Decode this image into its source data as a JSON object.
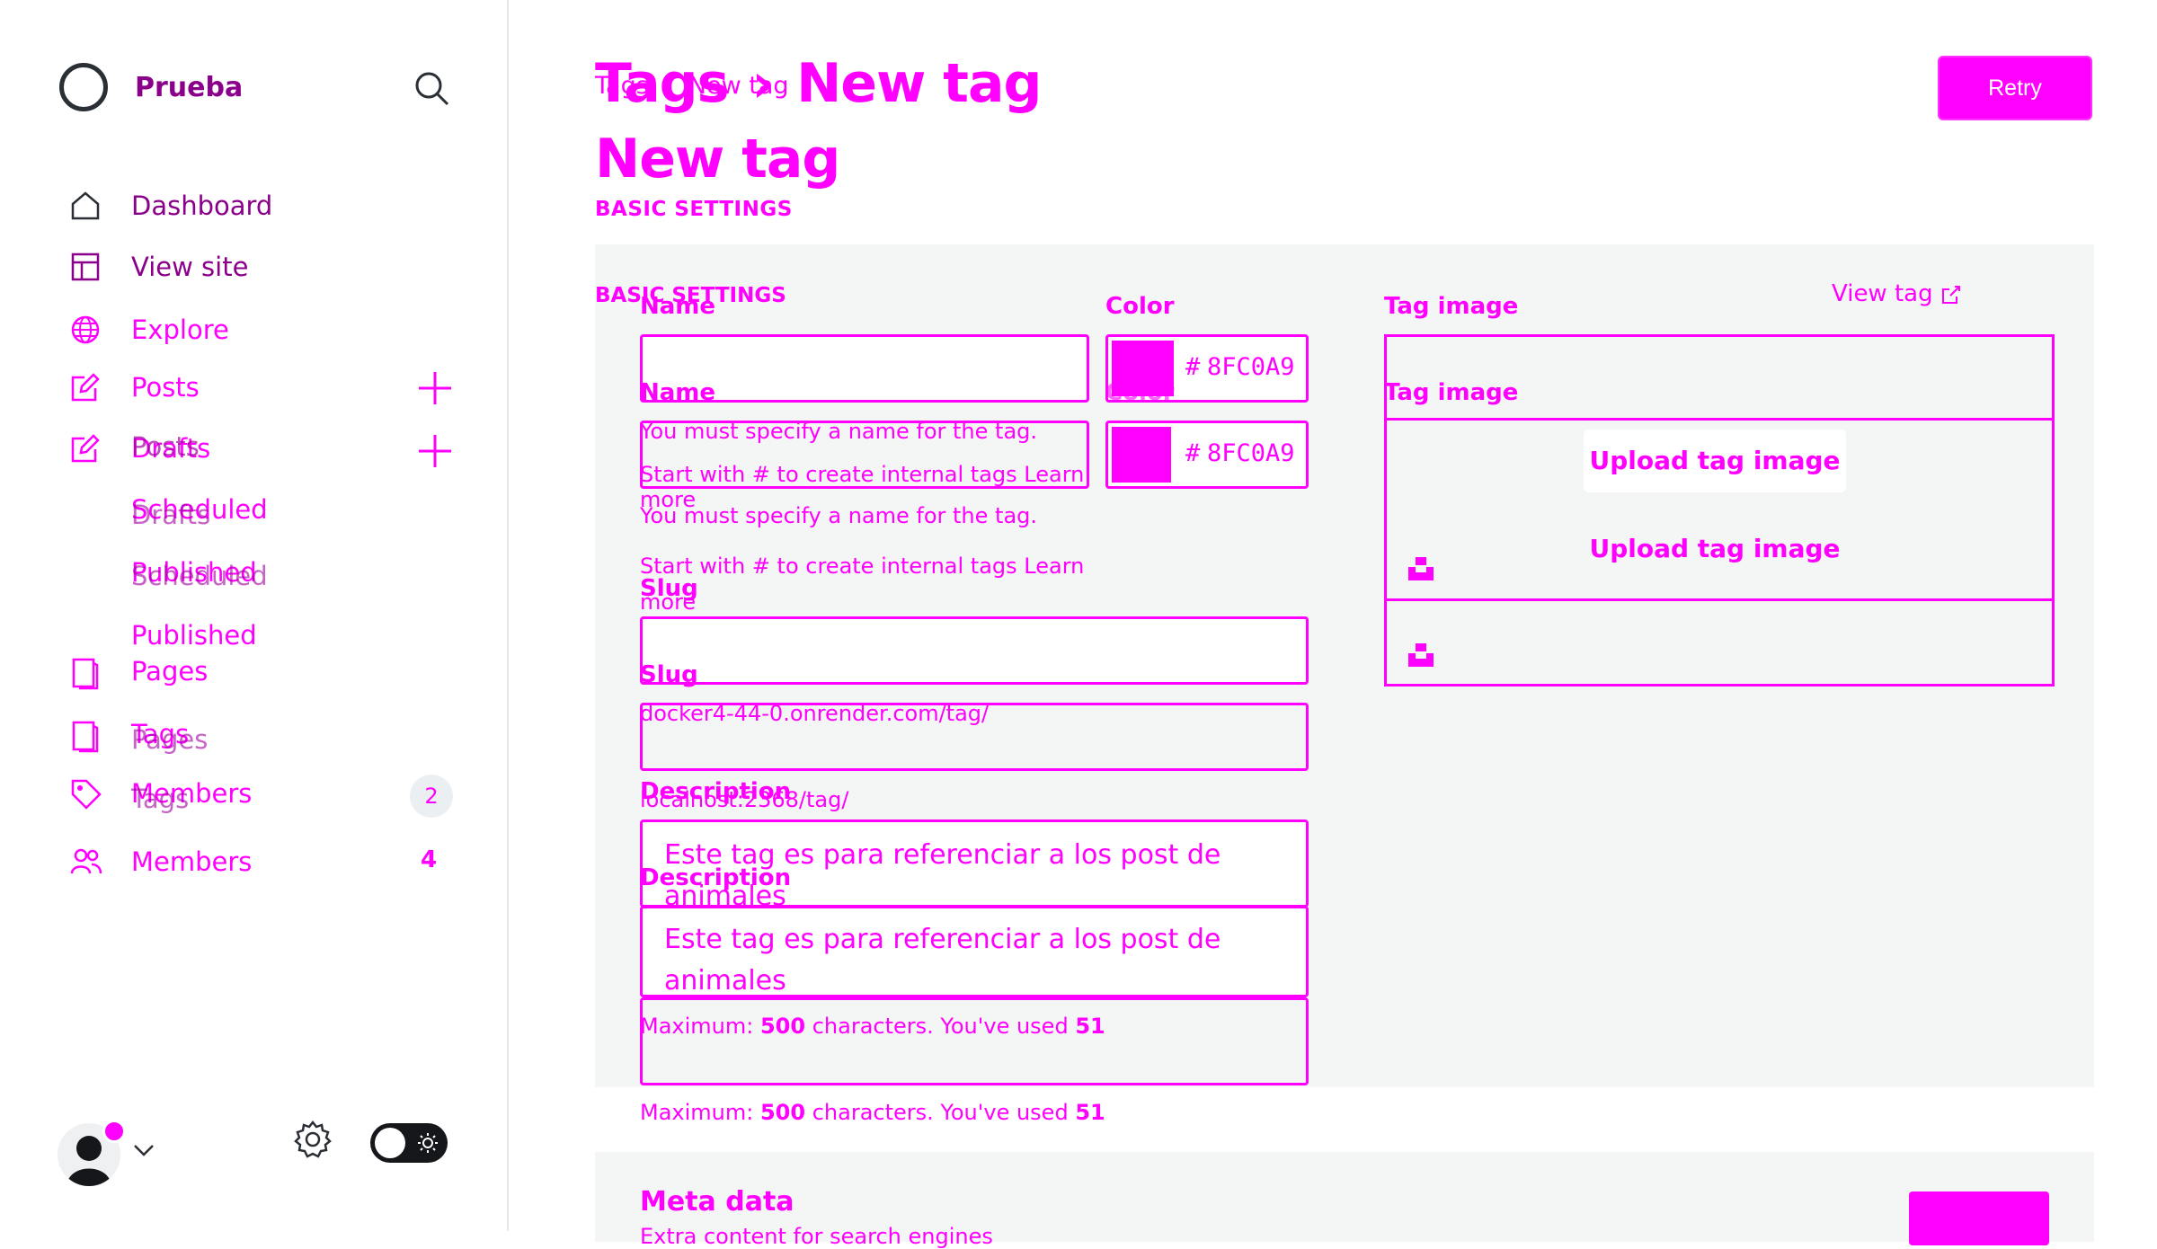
{
  "sidebar": {
    "brand": "Prueba",
    "nav": {
      "dashboard": "Dashboard",
      "view_site": "View site",
      "explore": "Explore",
      "posts": "Posts",
      "drafts": "Drafts",
      "scheduled": "Scheduled",
      "published": "Published",
      "pages": "Pages",
      "tags": "Tags",
      "members": "Members"
    },
    "members_count": "4",
    "members_count_ghost": "2"
  },
  "header": {
    "breadcrumb_parent": "Tags",
    "breadcrumb_current": "New tag",
    "title": "New tag",
    "retry_label": "Retry"
  },
  "form": {
    "section_label": "BASIC SETTINGS",
    "name_label": "Name",
    "name_value": "",
    "name_error": "You must specify a name for the tag.",
    "name_hint": "Start with # to create internal tags Learn more",
    "color_label": "Color",
    "color_hash": "#",
    "color_value": "8FC0A9",
    "slug_label": "Slug",
    "slug_value": "",
    "slug_url": "docker4-44-0.onrender.com/tag/",
    "slug_url_ghost": "localhost:2368/tag/",
    "description_label": "Description",
    "description_value": "Este tag es para referenciar a los post de animales",
    "max_prefix": "Maximum: ",
    "max_count": "500",
    "max_middle": " characters. You've used ",
    "used_count": "51",
    "image_label": "Tag image",
    "upload_label": "Upload tag image",
    "view_tag": "View tag"
  },
  "meta": {
    "title": "Meta data",
    "subtitle": "Extra content for search engines"
  },
  "colors": {
    "accent": "#FF00FF",
    "swatch": "#FF00FF"
  }
}
